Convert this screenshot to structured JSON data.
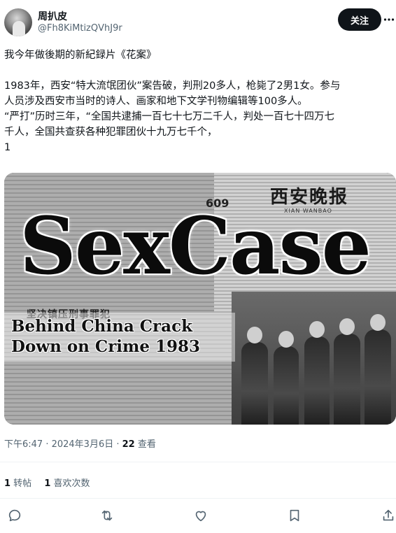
{
  "user": {
    "display_name": "周扒皮",
    "handle": "@Fh8KiMtizQVhJ9r",
    "follow_label": "关注"
  },
  "tweet": {
    "lines": [
      "我今年做後期的新紀録片《花案》",
      "1983年，西安“特大流氓团伙”案告破，判刑20多人，枪毙了2男1女。参与",
      "人员涉及西安市当时的诗人、画家和地下文学刊物编辑等100多人。",
      "“严打”历时三年，“全国共逮捕一百七十七万二千人，判处一百七十四万七",
      "千人，全国共查获各种犯罪团伙十九万七千个，",
      "1"
    ]
  },
  "media": {
    "title": "SexCase",
    "subtitle_line1": "Behind China Crack",
    "subtitle_line2": "Down on Crime 1983",
    "newspaper_title": "西安晚报",
    "newspaper_sub": "XIAN WANBAO",
    "newspaper_number": "609",
    "headline_cn": "坚决镇压刑事罪犯"
  },
  "meta": {
    "time": "下午6:47 · 2024年3月6日 · ",
    "views_count": "22",
    "views_label": " 查看"
  },
  "stats": {
    "reposts_count": "1",
    "reposts_label": " 转帖",
    "likes_count": "1",
    "likes_label": " 喜欢次数"
  },
  "icons": {
    "reply": "reply-icon",
    "repost": "repost-icon",
    "like": "like-icon",
    "bookmark": "bookmark-icon",
    "share": "share-icon",
    "more": "more-icon"
  },
  "colors": {
    "text": "#0f1419",
    "secondary": "#536471",
    "follow_bg": "#0f1419"
  }
}
